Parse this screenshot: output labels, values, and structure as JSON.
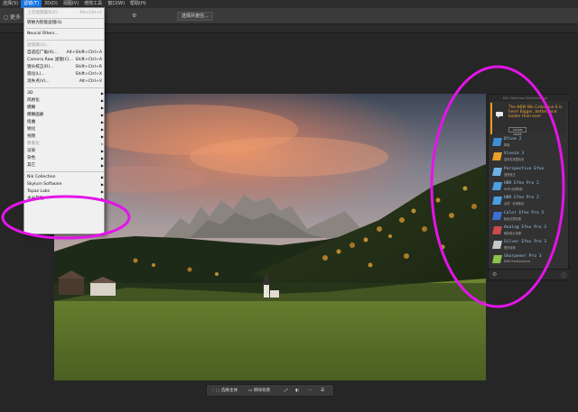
{
  "menubar": {
    "items": [
      "选择(S)",
      "滤镜(T)",
      "3D(D)",
      "视图(V)",
      "增效工具",
      "窗口(W)",
      "帮助(H)"
    ],
    "active_index": 1
  },
  "optbar": {
    "left_label": "◻ 更多",
    "select_mask_label": "选择并遮住..."
  },
  "filter_menu": {
    "items": [
      {
        "label": "上次滤镜操作(F)",
        "shortcut": "Alt+Ctrl+F",
        "dim": true
      },
      {
        "label": "转换为智能滤镜(S)",
        "shortcut": ""
      },
      {
        "label": "Neural Filters...",
        "shortcut": ""
      },
      {
        "label": "滤镜库(G)...",
        "shortcut": "",
        "dim": true
      },
      {
        "label": "自适应广角(A)...",
        "shortcut": "Alt+Shift+Ctrl+A"
      },
      {
        "label": "Camera Raw 滤镜(C)...",
        "shortcut": "Shift+Ctrl+A"
      },
      {
        "label": "镜头校正(R)...",
        "shortcut": "Shift+Ctrl+R"
      },
      {
        "label": "液化(L)...",
        "shortcut": "Shift+Ctrl+X"
      },
      {
        "label": "消失点(V)...",
        "shortcut": "Alt+Ctrl+V"
      },
      {
        "label": "3D",
        "submenu": true
      },
      {
        "label": "风格化",
        "submenu": true
      },
      {
        "label": "模糊",
        "submenu": true
      },
      {
        "label": "模糊画廊",
        "submenu": true
      },
      {
        "label": "扭曲",
        "submenu": true
      },
      {
        "label": "锐化",
        "submenu": true
      },
      {
        "label": "视频",
        "submenu": true
      },
      {
        "label": "像素化",
        "submenu": true,
        "dim": true
      },
      {
        "label": "渲染",
        "submenu": true
      },
      {
        "label": "杂色",
        "submenu": true
      },
      {
        "label": "其它",
        "submenu": true
      },
      {
        "label": "Nik Collection",
        "submenu": true
      },
      {
        "label": "Skylum Software",
        "submenu": true
      },
      {
        "label": "Topaz Labs",
        "submenu": true
      },
      {
        "label": "水长艺抠",
        "submenu": true
      }
    ]
  },
  "nik_panel": {
    "header": "Nik Collection Selective Tool",
    "banner_text": "The NEW Nik Collection 6 is here! Bigger, better, and bolder than ever.",
    "banner_button": "LEARN MORE",
    "items": [
      {
        "name": "Dfine 2",
        "sub": "降噪",
        "color": "#3d8fd6"
      },
      {
        "name": "Viveza 3",
        "sub": "选择性调整色彩",
        "color": "#e8a02a"
      },
      {
        "name": "Perspective Efex",
        "sub": "透视校正",
        "color": "#6fb3e6"
      },
      {
        "name": "HDR Efex Pro 2",
        "sub": "HDR 色调映射",
        "color": "#4aa0e0"
      },
      {
        "name": "HDR Efex Pro 2",
        "sub": "合成 · 色调映射",
        "color": "#4aa0e0"
      },
      {
        "name": "Color Efex Pro 5",
        "sub": "颜色滤镜效果",
        "color": "#3b6fd0"
      },
      {
        "name": "Analog Efex Pro 3",
        "sub": "模拟胶片效果",
        "color": "#c94b4b"
      },
      {
        "name": "Silver Efex Pro 3",
        "sub": "黑白转换",
        "color": "#c8c8c8"
      },
      {
        "name": "Sharpener Pro 3",
        "sub": "RAW Presharpener",
        "color": "#8bc34a"
      }
    ]
  },
  "context_bar": {
    "select_subject": "选择主体",
    "remove_bg": "移除背景"
  },
  "colors": {
    "accent": "#1473e6",
    "annotation": "#e414e8",
    "nik_orange": "#f29b1d"
  }
}
